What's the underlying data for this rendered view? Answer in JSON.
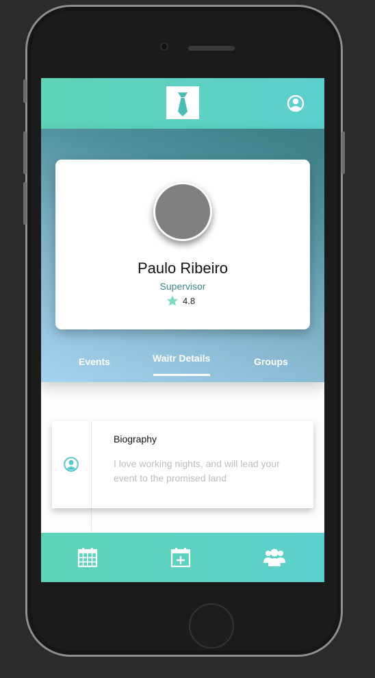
{
  "app": {
    "brand_color": "#5dd0c2",
    "logo_icon": "tie-icon",
    "account_icon": "user-circle-icon"
  },
  "profile": {
    "name": "Paulo Ribeiro",
    "role": "Supervisor",
    "rating": "4.8",
    "rating_icon": "star-icon",
    "role_color": "#3b8a8c"
  },
  "tabs": [
    {
      "label": "Events",
      "active": false
    },
    {
      "label": "Waitr Details",
      "active": true
    },
    {
      "label": "Groups",
      "active": false
    }
  ],
  "biography": {
    "title": "Biography",
    "text": "I love working nights, and will lead your event to the promised land",
    "icon": "user-circle-icon"
  },
  "bottom_nav": [
    {
      "icon": "calendar-icon"
    },
    {
      "icon": "calendar-add-icon"
    },
    {
      "icon": "group-icon"
    }
  ]
}
